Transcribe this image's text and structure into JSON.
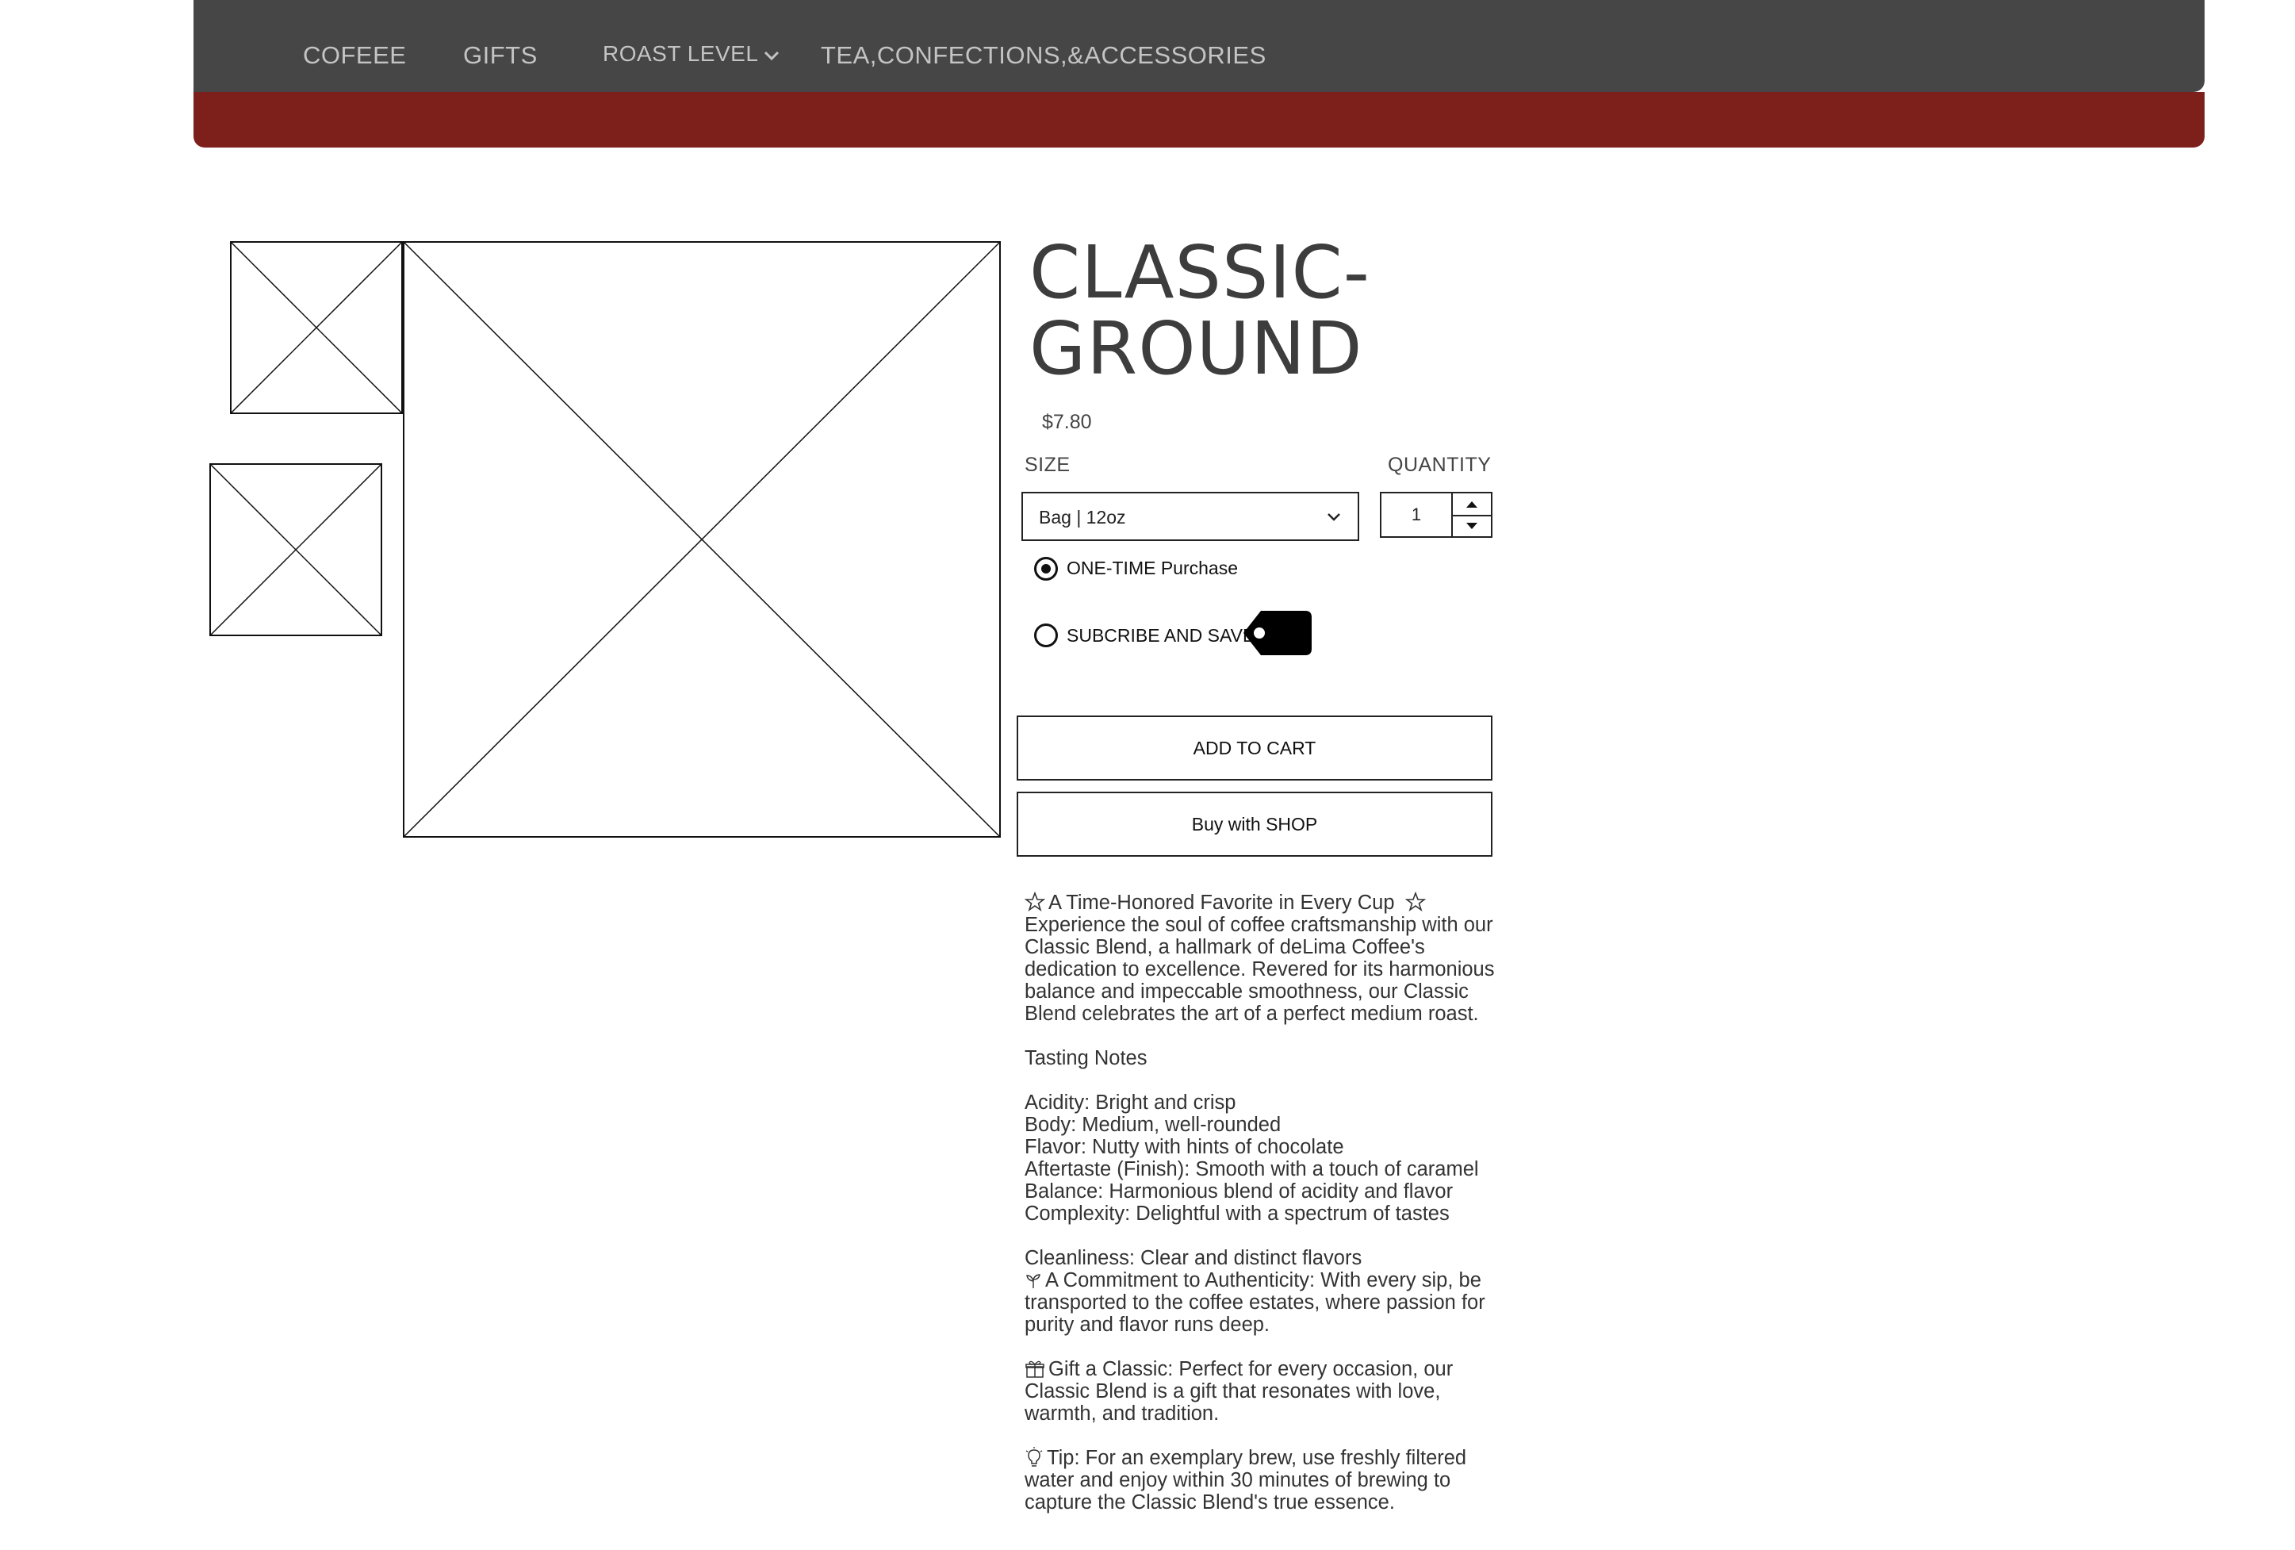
{
  "nav": {
    "items": [
      {
        "label": "COFEEE"
      },
      {
        "label": "GIFTS"
      },
      {
        "label": "ROAST LEVEL"
      },
      {
        "label": "TEA,CONFECTIONS,&ACCESSORIES"
      }
    ],
    "cart_icon": "shopping-cart-icon"
  },
  "colors": {
    "navbar": "#464646",
    "accent_bar": "#7d1f1a"
  },
  "product": {
    "title_line1": "CLASSIC-",
    "title_line2": "GROUND",
    "price": "$7.80",
    "size_label": "SIZE",
    "size_value": "Bag | 12oz",
    "quantity_label": "QUANTITY",
    "quantity_value": "1",
    "options": [
      {
        "label": "ONE-TIME Purchase",
        "selected": true
      },
      {
        "label": "SUBCRIBE AND SAVE",
        "selected": false
      }
    ],
    "add_to_cart": "ADD TO CART",
    "buy_with_shop": "Buy with SHOP"
  },
  "description": {
    "intro_heading": "A Time-Honored Favorite in Every Cup",
    "intro_body": "Experience the soul of coffee craftsmanship with our Classic Blend, a hallmark of deLima Coffee's dedication to excellence. Revered for its harmonious balance and impeccable smoothness, our Classic Blend celebrates the art of a perfect medium roast.",
    "tasting_heading": "Tasting Notes",
    "notes": [
      "Acidity: Bright and crisp",
      "Body: Medium, well-rounded",
      "Flavor: Nutty with hints of chocolate",
      "Aftertaste (Finish): Smooth with a touch of caramel",
      "Balance: Harmonious blend of acidity and flavor",
      "Complexity: Delightful with a spectrum of tastes"
    ],
    "cleanliness": "Cleanliness: Clear and distinct flavors",
    "authenticity": "A Commitment to Authenticity: With every sip, be transported to the coffee estates, where passion for purity and flavor runs deep.",
    "gift": "Gift a Classic: Perfect for every occasion, our Classic Blend is a gift that resonates with love, warmth, and tradition.",
    "tip": "Tip: For an exemplary brew, use freshly filtered water and enjoy within 30 minutes of brewing to capture the Classic Blend's true essence."
  }
}
